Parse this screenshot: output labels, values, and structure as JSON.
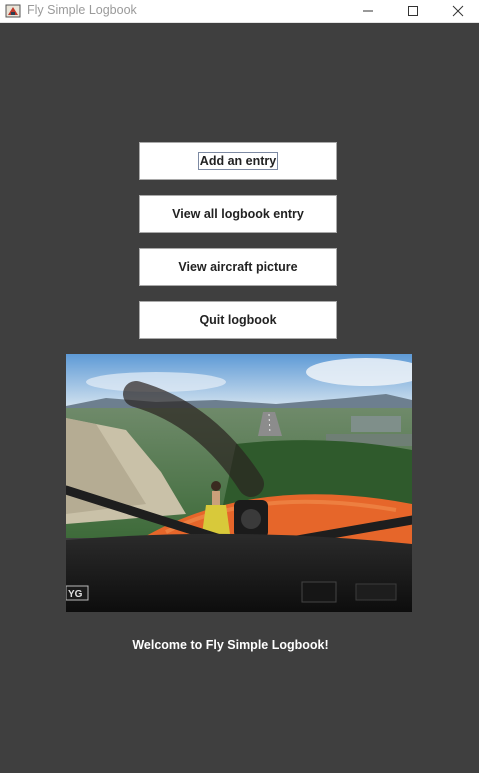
{
  "window": {
    "title": "Fly Simple Logbook",
    "icon": "logbook-app-icon",
    "controls": [
      "minimize-icon",
      "maximize-icon",
      "close-icon"
    ]
  },
  "buttons": {
    "add_entry": "Add an entry",
    "view_all": "View all logbook entry",
    "view_picture": "View aircraft picture",
    "quit": "Quit logbook"
  },
  "image": {
    "label": "YG"
  },
  "footer": {
    "welcome": "Welcome to Fly Simple Logbook!"
  },
  "colors": {
    "background": "#3f3f3f",
    "button_bg": "#ffffff",
    "title_text": "#9a9a9a",
    "welcome_text": "#ffffff"
  }
}
